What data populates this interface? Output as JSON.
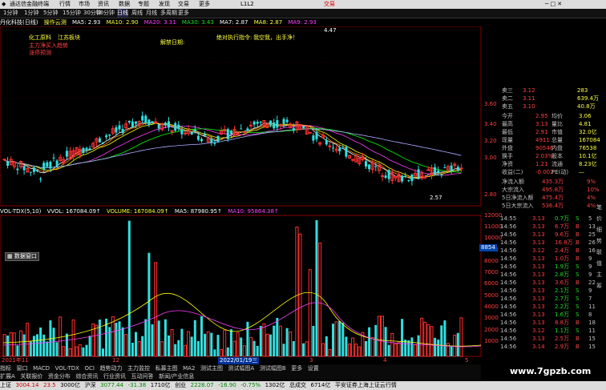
{
  "title_bar": {
    "app": "通达信金融终端",
    "menus": [
      "行情",
      "市场",
      "资讯",
      "数据",
      "专题",
      "发现",
      "交易",
      "更多"
    ],
    "right_label": "交易",
    "l_label": "L1L2"
  },
  "toolbar": {
    "periods": [
      "1分钟",
      "1分钟",
      "5分钟",
      "15分钟",
      "30分钟",
      "60分钟",
      "日线",
      "周线",
      "月线",
      "多周期"
    ],
    "more": "更多"
  },
  "ma_line": {
    "name": "丹化科技(日线)",
    "indicator": "操作云测",
    "ma5": "MA5: 2.93",
    "ma10": "MA10: 2.90",
    "ma20": "MA20: 3.31",
    "ma30": "MA30: 3.43",
    "ma7": "MA7: 2.87",
    "ma8": "MA8: 2.87",
    "ma9": "MA9: 2.93"
  },
  "chart_annotations": {
    "a1": "化工原料",
    "a2": "江苏板块",
    "a3": "主力净买入趋势",
    "a4": "涨停预测",
    "a5": "解禁日期:",
    "a6": "绝对执行指令:",
    "a7": "我空我，出手净！",
    "high": "4.47",
    "low": "2.57"
  },
  "price_axis": [
    "3.60",
    "3.40",
    "3.20",
    "3.00",
    "2.80"
  ],
  "vol_line": {
    "name": "VOL-TDX(5,10)",
    "vvol": "VVOL: 167084.09↑",
    "volume": "VOLUME: 167084.09↑",
    "ma5": "MA5: 87980.95↑",
    "ma10": "MA10: 95864.38↑"
  },
  "vol_axis": [
    "12000",
    "11000",
    "10000",
    "9000",
    "8000",
    "7000",
    "6000",
    "5000",
    "4000",
    "3000",
    "2000",
    "1000"
  ],
  "vol_marker": "8854",
  "date_axis": [
    "2021年11",
    "12",
    "2022/01/19三",
    "3",
    "4",
    "5"
  ],
  "bottom_tabs": [
    "指标",
    "窗口",
    "MACD",
    "VOL-TDX",
    "OCI",
    "趋势动力",
    "主力监控",
    "私募主图",
    "MA2",
    "测试主图",
    "测试幅图A",
    "测试幅图B",
    "更多",
    "设置"
  ],
  "bottom_tabs2": [
    "扩展A",
    "关联报价",
    "资金分布",
    "综合资讯",
    "行业资讯",
    "互动问答",
    "新闻/产业信息"
  ],
  "right_panel": {
    "sell": [
      {
        "label": "卖三",
        "price": "3.12",
        "vol": "283"
      },
      {
        "label": "卖二",
        "price": "3.11",
        "vol": "639.4万"
      },
      {
        "label": "卖五",
        "price": "3.10",
        "vol": "40.8万"
      }
    ],
    "quote": [
      {
        "l1": "今开",
        "v1": "2.95",
        "l2": "均价",
        "v2": "3.06"
      },
      {
        "l1": "最高",
        "v1": "3.13",
        "l2": "量比",
        "v2": "4.81"
      },
      {
        "l1": "最低",
        "v1": "2.91",
        "l2": "市值",
        "v2": "32.0亿"
      },
      {
        "l1": "现量",
        "v1": "4911",
        "l2": "总量",
        "v2": "167084"
      },
      {
        "l1": "外盘",
        "v1": "90546",
        "l2": "内盘",
        "v2": "76538"
      },
      {
        "l1": "换手",
        "v1": "2.03%",
        "l2": "股本",
        "v2": "10.1亿"
      },
      {
        "l1": "净资",
        "v1": "1.21",
        "l2": "流通",
        "v2": "8.23亿"
      },
      {
        "l1": "收益(二)",
        "v1": "-0.002",
        "l2": "PE(动)",
        "v2": "—"
      }
    ],
    "flows": [
      {
        "label": "净流入额",
        "val": "435.3万",
        "pct": "9%"
      },
      {
        "label": "大宗流入",
        "val": "495.8万",
        "pct": "10%"
      },
      {
        "label": "5日净流入额",
        "val": "475.4万",
        "pct": "4%"
      },
      {
        "label": "5日大宗流入",
        "val": "536.4万",
        "pct": "4%"
      }
    ],
    "ticks": [
      {
        "t": "14:55",
        "p": "3.13",
        "v": "0.7",
        "s": "S",
        "n": "5"
      },
      {
        "t": "14:56",
        "p": "3.13",
        "v": "6.7",
        "s": "B",
        "n": "13"
      },
      {
        "t": "14:56",
        "p": "3.13",
        "v": "9.6",
        "s": "B",
        "n": "25"
      },
      {
        "t": "14:56",
        "p": "3.13",
        "v": "16.8",
        "s": "B",
        "n": "26"
      },
      {
        "t": "14:56",
        "p": "3.12",
        "v": "2.4",
        "s": "B",
        "n": "16"
      },
      {
        "t": "14:56",
        "p": "3.13",
        "v": "1.0",
        "s": "B",
        "n": "9"
      },
      {
        "t": "14:56",
        "p": "3.13",
        "v": "1.9",
        "s": "S",
        "n": "9"
      },
      {
        "t": "14:56",
        "p": "3.13",
        "v": "2.8",
        "s": "S",
        "n": "9"
      },
      {
        "t": "14:56",
        "p": "3.13",
        "v": "3.6",
        "s": "B",
        "n": "22"
      },
      {
        "t": "14:56",
        "p": "3.13",
        "v": "2.1",
        "s": "S",
        "n": "9"
      },
      {
        "t": "14:56",
        "p": "3.13",
        "v": "2.7",
        "s": "S",
        "n": "7"
      },
      {
        "t": "14:56",
        "p": "3.13",
        "v": "2.2",
        "s": "S",
        "n": "11"
      },
      {
        "t": "14:56",
        "p": "3.13",
        "v": "1.6",
        "s": "S",
        "n": "8"
      },
      {
        "t": "14:56",
        "p": "3.13",
        "v": "8.8",
        "s": "B",
        "n": "18"
      },
      {
        "t": "14:56",
        "p": "3.12",
        "v": "1.1",
        "s": "S",
        "n": "11"
      },
      {
        "t": "14:56",
        "p": "3.13",
        "v": "2.5",
        "s": "B",
        "n": "15"
      },
      {
        "t": "14:56",
        "p": "3.14",
        "v": "2.9",
        "s": "B",
        "n": "15"
      }
    ]
  },
  "right_tabs": [
    "笔",
    "价",
    "细",
    "势",
    "联",
    "值",
    "主",
    "筹"
  ],
  "status_bar": {
    "sh": "上证",
    "sh_val": "3004.14",
    "sh_chg": "23.5",
    "sh_amt": "3000亿",
    "hs": "沪深",
    "hs_val": "3077.44",
    "hs_chg": "-31.38",
    "hs_amt": "1710亿",
    "cy": "创业",
    "cy_val": "2228.07",
    "cy_chg": "-16.90",
    "cy_pct": "-0.75%",
    "cy_amt": "1302亿",
    "zs": "总成交",
    "zs_val": "6714亿",
    "broker": "平安证券上海上证云行情"
  },
  "watermark": "www.7gpzb.com",
  "colors": {
    "up": "#ff3030",
    "down": "#30e0e0",
    "ma5": "#ffffff",
    "ma10": "#ffff00",
    "ma20": "#ff40ff",
    "ma30": "#00ff00"
  }
}
